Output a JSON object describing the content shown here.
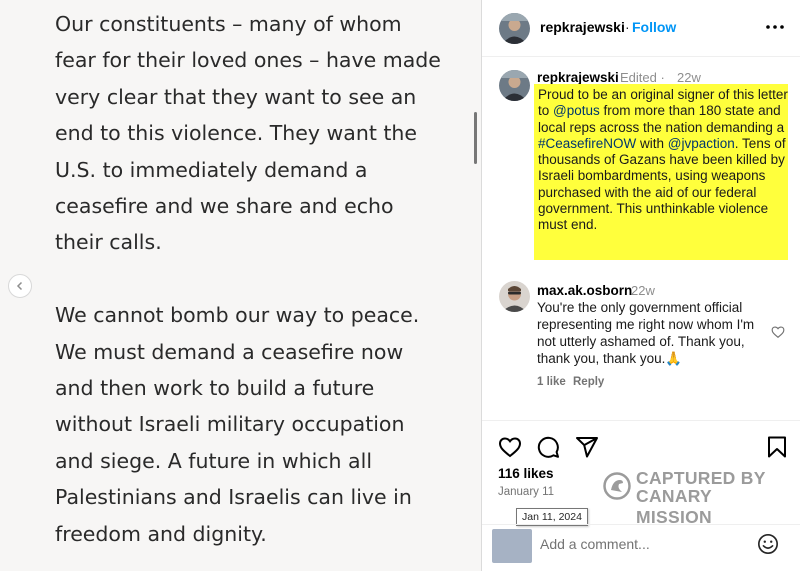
{
  "post_image": {
    "paragraph_1": "Our constituents – many of whom\nfear for their loved ones – have made\nvery clear that they want to see an\nend to this violence. They want the\nU.S. to immediately demand a\nceasefire and we share and echo\ntheir calls.",
    "paragraph_2": "We cannot bomb our way to peace.\nWe must demand a ceasefire now\nand then work to build a future\nwithout Israeli military occupation\nand siege. A future in which all\nPalestinians and Israelis can live in\nfreedom and dignity."
  },
  "header": {
    "username": "repkrajewski",
    "separator": "·",
    "follow_label": "Follow"
  },
  "caption": {
    "username": "repkrajewski",
    "edited_label": "Edited ·",
    "time": "22w",
    "text_1": "Proud to be an original signer of this letter to ",
    "mention_1": "@potus",
    "text_2": " from more than 180 state and local reps across the nation demanding a ",
    "hashtag": "#CeasefireNOW",
    "text_3": " with ",
    "mention_2": "@jvpaction",
    "text_4": ". Tens of thousands of Gazans have been killed by Israeli bombardments, using weapons purchased with the aid of our federal government. This unthinkable violence must end.",
    "highlight_color": "#ffff3c"
  },
  "comment": {
    "username": "max.ak.osborn",
    "time": "22w",
    "text": "You're the only government official representing me right now whom I'm not utterly ashamed of. Thank you, thank you, thank you.🙏",
    "likes_label": "1 like",
    "reply_label": "Reply"
  },
  "actions": {
    "like_icon": "heart-icon",
    "comment_icon": "comment-icon",
    "share_icon": "share-icon",
    "save_icon": "bookmark-icon"
  },
  "likes_label": "116 likes",
  "date_label": "January 11",
  "date_tooltip": "Jan 11, 2024",
  "comment_input": {
    "placeholder": "Add a comment..."
  },
  "watermark": {
    "line_1": "CAPTURED BY",
    "line_2": "CANARY MISSION"
  },
  "colors": {
    "link_blue": "#0095f6",
    "mention_blue": "#00376b",
    "secondary_text": "#8e8e8e"
  }
}
